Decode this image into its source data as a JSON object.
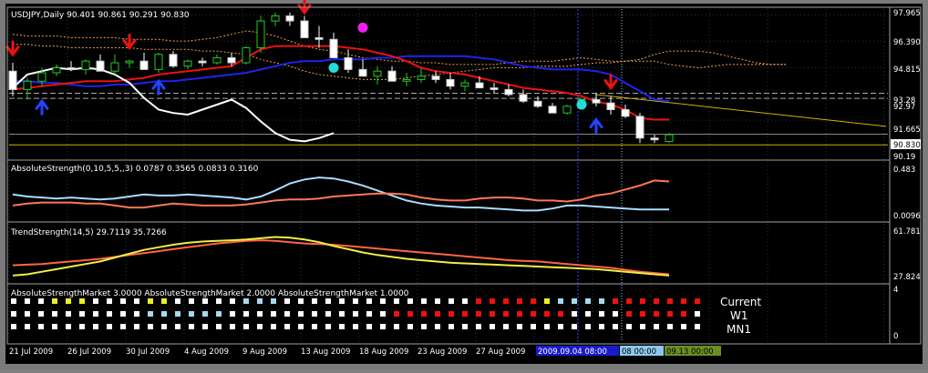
{
  "window": {
    "bg": "#000000",
    "grid_color": "#3a4454",
    "text_color": "#ffffff"
  },
  "main": {
    "header": "USDJPY,Daily  90.401 90.861 90.291 90.830",
    "price_labels": [
      "97.965",
      "96.390",
      "94.815",
      "93.28",
      "92.97",
      "91.665",
      "90.830",
      "90.19"
    ],
    "current_price": "90.830"
  },
  "panel_abs": {
    "header": "AbsoluteStrength(0,10,5,5,,3) 0.0787 0.3565 0.0833 0.3160",
    "labels": [
      "0.483",
      "0.0096"
    ]
  },
  "panel_trend": {
    "header": "TrendStrength(14,5) 29.7119 35.7266",
    "labels": [
      "61.781",
      "27.824"
    ]
  },
  "panel_market": {
    "header": "AbsoluteStrengthMarket 3.0000  AbsoluteStrengthMarket 2.0000  AbsoluteStrengthMarket 1.0000",
    "labels": [
      "4",
      "0"
    ],
    "timeframes": [
      "Current",
      "W1",
      "MN1"
    ]
  },
  "dates": [
    "21 Jul 2009",
    "26 Jul 2009",
    "30 Jul 2009",
    "4 Aug 2009",
    "9 Aug 2009",
    "13 Aug 2009",
    "18 Aug 2009",
    "23 Aug 2009",
    "27 Aug 2009"
  ],
  "time_markers": [
    {
      "text": "2009.09.04 08:00",
      "color": "#1a1acc"
    },
    {
      "text": "08 00:00",
      "color": "#8fc8ee"
    },
    {
      "text": "09.13 00:00",
      "color": "#6b8e23"
    }
  ],
  "colors": {
    "up_body": "#000000",
    "up_border": "#22cc22",
    "down_body": "#ffffff",
    "kijun": "#ee1111",
    "tenkan": "#2222ee",
    "chikou": "#ffffff",
    "cloud": "#e8a050",
    "trendline": "#d4b000",
    "arrow_down": "#ee1111",
    "arrow_up": "#2244ff",
    "dot_cyan": "#22dddd",
    "dot_magenta": "#ee22ee",
    "abs_bull": "#ff7755",
    "abs_bear": "#aaddff",
    "trend_line1": "#ff6644",
    "trend_line2": "#eeee44",
    "sig_red": "#ee1111",
    "sig_white": "#ffffff",
    "sig_lblue": "#a8d8f0",
    "sig_yellow": "#eeee22"
  },
  "chart_data": [
    {
      "type": "candlestick",
      "title": "USDJPY,Daily",
      "x_start": "2009-07-21",
      "x_end": "2009-09-03",
      "ylim": [
        89.5,
        98.2
      ],
      "ohlc": [
        [
          94.6,
          95.1,
          93.1,
          93.5
        ],
        [
          93.5,
          94.2,
          92.9,
          94.0
        ],
        [
          94.0,
          94.8,
          93.7,
          94.5
        ],
        [
          94.5,
          95.0,
          94.3,
          94.8
        ],
        [
          94.8,
          95.2,
          94.6,
          94.7
        ],
        [
          94.7,
          95.3,
          94.4,
          95.2
        ],
        [
          95.2,
          95.6,
          94.8,
          94.6
        ],
        [
          94.6,
          95.6,
          94.4,
          95.1
        ],
        [
          95.1,
          95.3,
          94.8,
          95.2
        ],
        [
          95.2,
          95.7,
          94.8,
          94.7
        ],
        [
          94.7,
          95.7,
          94.5,
          95.6
        ],
        [
          95.6,
          95.8,
          94.8,
          94.9
        ],
        [
          94.9,
          95.3,
          94.7,
          95.2
        ],
        [
          95.2,
          95.4,
          94.9,
          95.1
        ],
        [
          95.1,
          95.6,
          95.0,
          95.4
        ],
        [
          95.4,
          95.7,
          94.9,
          95.1
        ],
        [
          95.1,
          96.1,
          95.0,
          96.0
        ],
        [
          96.0,
          97.9,
          95.7,
          97.6
        ],
        [
          97.6,
          98.1,
          97.3,
          97.9
        ],
        [
          97.9,
          98.1,
          97.3,
          97.6
        ],
        [
          97.6,
          97.9,
          96.9,
          96.6
        ],
        [
          96.6,
          97.3,
          96.0,
          96.5
        ],
        [
          96.5,
          96.9,
          95.5,
          95.4
        ],
        [
          95.4,
          95.9,
          94.5,
          94.7
        ],
        [
          94.7,
          95.3,
          94.5,
          94.3
        ],
        [
          94.3,
          94.9,
          93.8,
          94.6
        ],
        [
          94.6,
          94.9,
          94.0,
          94.0
        ],
        [
          94.0,
          94.5,
          93.7,
          94.1
        ],
        [
          94.1,
          94.8,
          93.9,
          94.3
        ],
        [
          94.3,
          94.6,
          93.9,
          94.1
        ],
        [
          94.1,
          94.5,
          93.5,
          93.7
        ],
        [
          93.7,
          94.1,
          93.4,
          93.9
        ],
        [
          93.9,
          94.3,
          93.6,
          93.6
        ],
        [
          93.6,
          93.9,
          93.3,
          93.5
        ],
        [
          93.5,
          93.8,
          93.1,
          93.2
        ],
        [
          93.2,
          93.5,
          92.7,
          92.8
        ],
        [
          92.8,
          93.1,
          92.4,
          92.5
        ],
        [
          92.5,
          92.7,
          92.1,
          92.1
        ],
        [
          92.1,
          92.6,
          92.0,
          92.5
        ],
        [
          92.5,
          93.0,
          92.3,
          92.9
        ],
        [
          92.9,
          93.3,
          92.5,
          92.7
        ],
        [
          92.7,
          93.1,
          92.0,
          92.3
        ],
        [
          92.3,
          92.6,
          91.8,
          91.9
        ],
        [
          91.9,
          92.1,
          90.3,
          90.6
        ],
        [
          90.6,
          90.8,
          90.3,
          90.5
        ],
        [
          90.4,
          90.9,
          90.3,
          90.8
        ]
      ],
      "kijun": [
        93.5,
        93.6,
        93.7,
        93.8,
        93.9,
        94.0,
        94.0,
        94.0,
        94.1,
        94.2,
        94.4,
        94.5,
        94.6,
        94.7,
        94.8,
        94.9,
        95.4,
        95.9,
        96.1,
        96.1,
        96.1,
        96.1,
        96.1,
        96.0,
        95.9,
        95.7,
        95.5,
        95.2,
        94.8,
        94.6,
        94.5,
        94.4,
        94.2,
        94.0,
        93.8,
        93.6,
        93.5,
        93.4,
        93.3,
        93.1,
        92.8,
        92.6,
        92.3,
        91.8,
        91.7,
        91.7
      ],
      "tenkan": [
        94.0,
        94.0,
        93.9,
        93.9,
        93.8,
        93.7,
        93.7,
        93.8,
        93.8,
        93.9,
        94.0,
        94.0,
        94.1,
        94.2,
        94.3,
        94.4,
        94.5,
        94.7,
        94.9,
        95.1,
        95.2,
        95.2,
        95.3,
        95.3,
        95.3,
        95.4,
        95.4,
        95.5,
        95.5,
        95.5,
        95.5,
        95.5,
        95.4,
        95.3,
        95.1,
        94.9,
        94.8,
        94.7,
        94.7,
        94.7,
        94.6,
        94.4,
        93.9,
        93.4,
        92.9,
        92.8
      ],
      "chikou": [
        93.6,
        94.4,
        94.6,
        94.8,
        94.7,
        94.8,
        94.7,
        94.4,
        93.9,
        93.0,
        92.3,
        92.1,
        92.0,
        92.3,
        92.6,
        92.9,
        92.4,
        91.6,
        90.9,
        90.5,
        90.4,
        90.6,
        90.9
      ],
      "cloud_top": [
        96.8,
        96.7,
        96.7,
        96.7,
        96.6,
        96.6,
        96.6,
        96.6,
        96.5,
        96.5,
        96.5,
        96.4,
        96.4,
        96.5,
        96.6,
        96.8,
        97.0,
        96.9,
        96.7,
        96.4,
        96.1,
        95.9,
        95.8,
        95.6,
        95.4,
        95.3,
        95.2,
        95.2,
        95.1,
        95.1,
        95.0,
        95.0,
        95.0,
        95.0,
        95.1,
        95.2,
        95.2,
        95.2,
        95.3,
        95.4,
        95.3,
        95.2,
        95.2,
        95.3,
        95.6,
        95.8,
        95.8,
        95.8,
        95.7,
        95.5,
        95.3,
        95.1,
        95.0,
        95.0
      ],
      "cloud_bottom": [
        96.2,
        96.2,
        96.1,
        96.1,
        96.0,
        96.0,
        96.0,
        96.0,
        96.0,
        95.9,
        95.9,
        95.9,
        95.9,
        95.8,
        95.8,
        95.7,
        95.6,
        95.3,
        95.1,
        94.9,
        94.6,
        94.4,
        94.3,
        94.2,
        94.1,
        94.1,
        94.1,
        94.2,
        94.3,
        94.4,
        94.5,
        94.6,
        94.7,
        94.8,
        94.8,
        94.8,
        94.9,
        94.9,
        94.9,
        95.0,
        95.1,
        95.1,
        95.2,
        95.2,
        95.2,
        95.0,
        94.9,
        94.8,
        94.9,
        95.0,
        95.0,
        95.0,
        95.0,
        95.0
      ],
      "arrows_down": [
        {
          "bar": 0,
          "price": 95.6
        },
        {
          "bar": 8,
          "price": 96.0
        },
        {
          "bar": 20,
          "price": 98.1
        },
        {
          "bar": 41,
          "price": 93.6
        }
      ],
      "arrows_up": [
        {
          "bar": 2,
          "price": 92.8
        },
        {
          "bar": 10,
          "price": 94.0
        },
        {
          "bar": 40,
          "price": 91.7
        }
      ],
      "dots": [
        {
          "bar": 22,
          "price": 94.8,
          "color": "cyan"
        },
        {
          "bar": 24,
          "price": 97.2,
          "color": "magenta"
        },
        {
          "bar": 39,
          "price": 92.6,
          "color": "cyan"
        }
      ]
    },
    {
      "type": "line",
      "title": "AbsoluteStrength(0,10,5,5,,3)",
      "ylim": [
        0.0096,
        0.483
      ],
      "series": [
        {
          "values": [
            0.23,
            0.21,
            0.2,
            0.19,
            0.2,
            0.19,
            0.18,
            0.19,
            0.21,
            0.23,
            0.22,
            0.22,
            0.23,
            0.22,
            0.21,
            0.2,
            0.18,
            0.21,
            0.27,
            0.34,
            0.38,
            0.4,
            0.39,
            0.36,
            0.32,
            0.27,
            0.22,
            0.17,
            0.14,
            0.12,
            0.11,
            0.1,
            0.1,
            0.09,
            0.08,
            0.07,
            0.07,
            0.09,
            0.12,
            0.12,
            0.11,
            0.1,
            0.09,
            0.08,
            0.08,
            0.08
          ]
        },
        {
          "values": [
            0.12,
            0.14,
            0.15,
            0.15,
            0.15,
            0.14,
            0.14,
            0.12,
            0.1,
            0.1,
            0.12,
            0.14,
            0.13,
            0.12,
            0.12,
            0.12,
            0.13,
            0.15,
            0.17,
            0.18,
            0.18,
            0.19,
            0.21,
            0.22,
            0.23,
            0.24,
            0.24,
            0.23,
            0.2,
            0.18,
            0.17,
            0.17,
            0.19,
            0.2,
            0.2,
            0.19,
            0.17,
            0.17,
            0.16,
            0.18,
            0.22,
            0.24,
            0.28,
            0.32,
            0.37,
            0.36
          ]
        }
      ]
    },
    {
      "type": "line",
      "title": "TrendStrength(14,5)",
      "ylim": [
        27.824,
        61.781
      ],
      "series": [
        {
          "values": [
            38,
            38.5,
            39,
            40,
            41,
            42,
            43,
            44.5,
            46,
            47.5,
            49,
            50.5,
            52,
            53.5,
            55,
            56,
            57,
            57.5,
            57,
            56,
            55,
            54.5,
            54,
            53,
            52,
            51,
            50,
            49,
            48,
            47,
            46,
            45,
            44,
            43,
            42,
            41.5,
            41,
            40,
            39,
            38,
            37,
            36,
            34.5,
            33,
            32,
            31
          ]
        },
        {
          "values": [
            30,
            31,
            33,
            35,
            37,
            39,
            41,
            44,
            47,
            50,
            52,
            54,
            55.5,
            56.5,
            57,
            57.5,
            58,
            59,
            60,
            59.5,
            58,
            56,
            53,
            50.5,
            48,
            46,
            44.5,
            43,
            42,
            41,
            40,
            39.5,
            39,
            38.5,
            38,
            37.5,
            37,
            36.5,
            36,
            35.5,
            35,
            34,
            33,
            32,
            31,
            30
          ]
        }
      ]
    }
  ]
}
